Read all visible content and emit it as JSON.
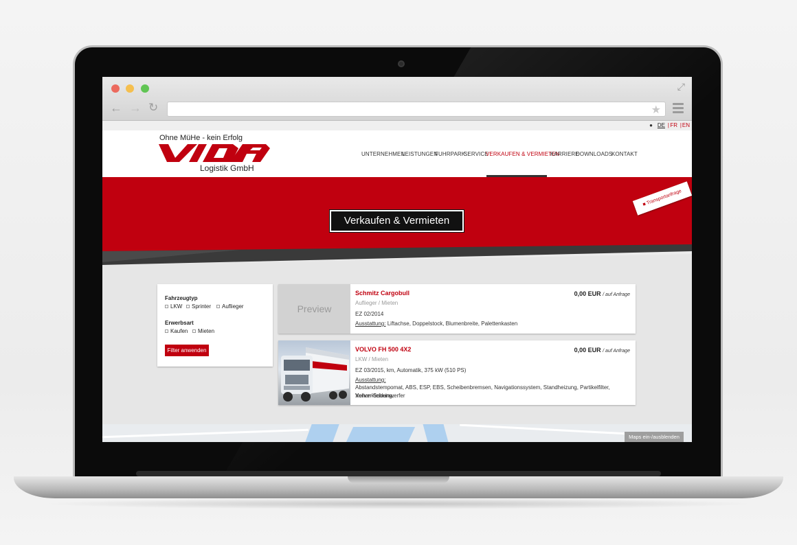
{
  "browser": {
    "url": ""
  },
  "lang": {
    "de": "DE",
    "fr": "FR",
    "en": "EN",
    "sep": "|"
  },
  "header": {
    "slogan": "Ohne MüHe - kein Erfolg",
    "logo_sub": "Logistik GmbH",
    "nav": [
      "UNTERNEHMEN",
      "LEISTUNGEN",
      "FUHRPARK",
      "SERVICE",
      "VERKAUFEN & VERMIETEN",
      "KARRIERE",
      "DOWNLOADS",
      "KONTAKT"
    ]
  },
  "hero": {
    "title": "Verkaufen & Vermieten",
    "badge": "Transportanfrage"
  },
  "filter": {
    "type_heading": "Fahrzeugtyp",
    "type_options": [
      "LKW",
      "Sprinter",
      "Auflieger"
    ],
    "acquire_heading": "Erwerbsart",
    "acquire_options": [
      "Kaufen",
      "Mieten"
    ],
    "apply_label": "Filter anwenden"
  },
  "listings": [
    {
      "title": "Schmitz Cargobull",
      "image_label": "Preview",
      "price": "0,00 EUR",
      "price_note": "/ auf Anfrage",
      "category": "Auflieger /  Mieten",
      "ez": "EZ 02/2014",
      "equip_label": "Ausstattung:",
      "equip_text": "Liftachse, Doppelstock, Blumenbreite, Palettenkasten"
    },
    {
      "title": "VOLVO FH 500 4X2",
      "price": "0,00 EUR",
      "price_note": "/ auf Anfrage",
      "category": "LKW /  Mieten",
      "ez": "EZ 03/2015, km, Automatik, 375 kW (510 PS)",
      "equip_label": "Ausstattung:",
      "equip_text_1": "Abstandstempomat, ABS, ESP, EBS, Scheibenbremsen, Navigationssystem, Standheizung, Partikelfilter, Vollverkleidung,",
      "equip_text_2": "Xenon-Scheinwerfer"
    }
  ],
  "map": {
    "toggle_label": "Maps ein-/ausblenden"
  },
  "colors": {
    "brand_red": "#c0000f",
    "dark": "#111111"
  }
}
